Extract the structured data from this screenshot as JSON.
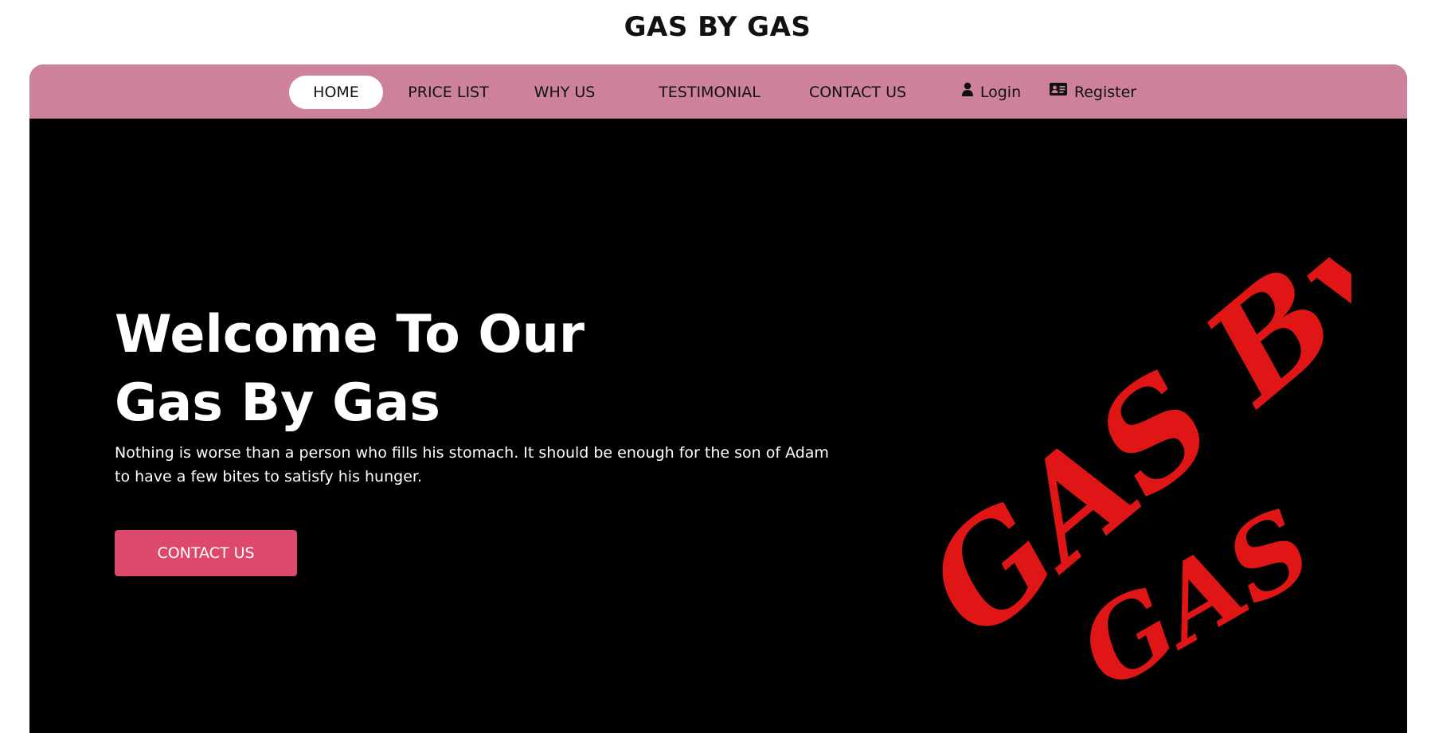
{
  "header": {
    "site_title": "GAS BY GAS"
  },
  "nav": {
    "items": [
      {
        "label": "HOME",
        "active": true
      },
      {
        "label": "PRICE LIST",
        "active": false
      },
      {
        "label": "WHY US",
        "active": false
      },
      {
        "label": "TESTIMONIAL",
        "active": false
      },
      {
        "label": "CONTACT US",
        "active": false
      }
    ],
    "login_label": "Login",
    "register_label": "Register",
    "login_icon": "user-icon",
    "register_icon": "id-card-icon"
  },
  "hero": {
    "title_line1": "Welcome To Our",
    "title_line2": "Gas By Gas",
    "description": "Nothing is worse than a person who fills his stomach. It should be enough for the son of Adam to have a few bites to satisfy his hunger.",
    "cta_label": "CONTACT US"
  },
  "logo": {
    "line1": "GAS By",
    "line2": "GAS"
  },
  "colors": {
    "nav_background": "#cd8299",
    "hero_background": "#000000",
    "cta_background": "#de486a",
    "logo_red": "#e01515",
    "text_light": "#ffffff"
  }
}
